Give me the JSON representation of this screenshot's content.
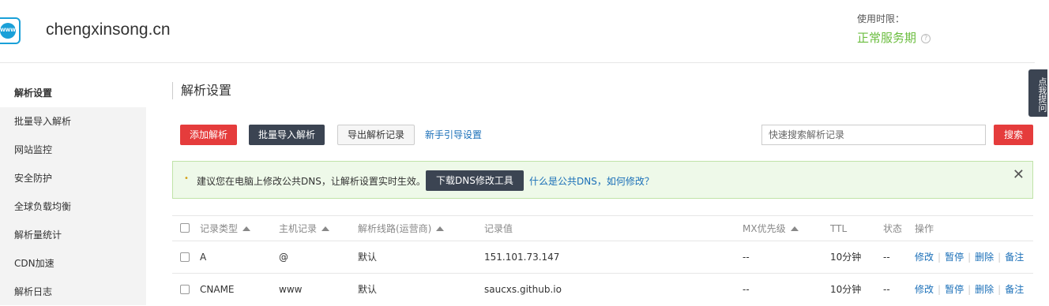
{
  "header": {
    "domain": "chengxinsong.cn",
    "logo_text": "WWW",
    "expire_label": "使用时限：",
    "expire_value": "正常服务期",
    "help_icon": "?"
  },
  "sidebar": {
    "items": [
      {
        "label": "解析设置",
        "active": true
      },
      {
        "label": "批量导入解析"
      },
      {
        "label": "网站监控"
      },
      {
        "label": "安全防护"
      },
      {
        "label": "全球负载均衡"
      },
      {
        "label": "解析量统计"
      },
      {
        "label": "CDN加速"
      },
      {
        "label": "解析日志"
      }
    ]
  },
  "main": {
    "title": "解析设置",
    "toolbar": {
      "add_label": "添加解析",
      "import_label": "批量导入解析",
      "export_label": "导出解析记录",
      "guide_label": "新手引导设置",
      "search_placeholder": "快速搜索解析记录",
      "search_label": "搜索"
    },
    "notice": {
      "bullet": "•",
      "text": "建议您在电脑上修改公共DNS，让解析设置实时生效。",
      "download_label": "下载DNS修改工具",
      "link_label": "什么是公共DNS，如何修改？",
      "close": "✕"
    },
    "table": {
      "headers": {
        "type": "记录类型",
        "host": "主机记录",
        "line": "解析线路(运营商)",
        "value": "记录值",
        "mx": "MX优先级",
        "ttl": "TTL",
        "status": "状态",
        "ops": "操作"
      },
      "rows": [
        {
          "type": "A",
          "host": "@",
          "line": "默认",
          "value": "151.101.73.147",
          "mx": "--",
          "ttl": "10分钟",
          "status": "--"
        },
        {
          "type": "CNAME",
          "host": "www",
          "line": "默认",
          "value": "saucxs.github.io",
          "mx": "--",
          "ttl": "10分钟",
          "status": "--"
        }
      ],
      "ops": {
        "edit": "修改",
        "pause": "暂停",
        "delete": "删除",
        "note": "备注",
        "sep": "|"
      }
    }
  },
  "feedback_tab": "点我提问",
  "colors": {
    "accent_red": "#e53c3c",
    "dark": "#3b4452",
    "link": "#1a6fb8",
    "ok_green": "#6bbd3f"
  }
}
